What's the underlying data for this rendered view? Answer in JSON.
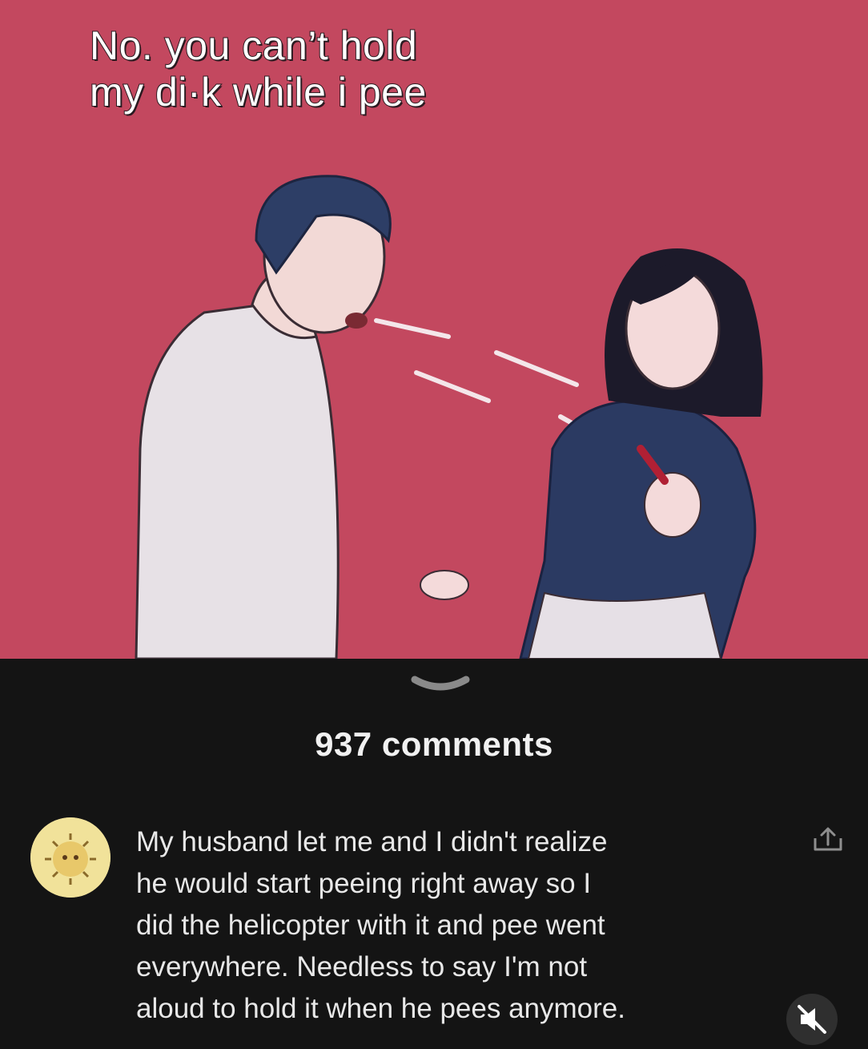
{
  "meme": {
    "caption_line1": "No. you can’t hold",
    "caption_line2": "my di·k while i pee",
    "background_color": "#c3485f"
  },
  "comments": {
    "count_label": "937 comments",
    "first_comment": {
      "avatar": "user-avatar-icon",
      "text": "My husband let me and I didn't realize\nhe would start peeing right away so I\ndid the helicopter with it and pee went\neverywhere. Needless to say I'm not\naloud to hold it when he pees anymore."
    }
  },
  "icons": {
    "collapse": "chevron-down-icon",
    "share": "share-icon",
    "mute": "mute-icon"
  }
}
